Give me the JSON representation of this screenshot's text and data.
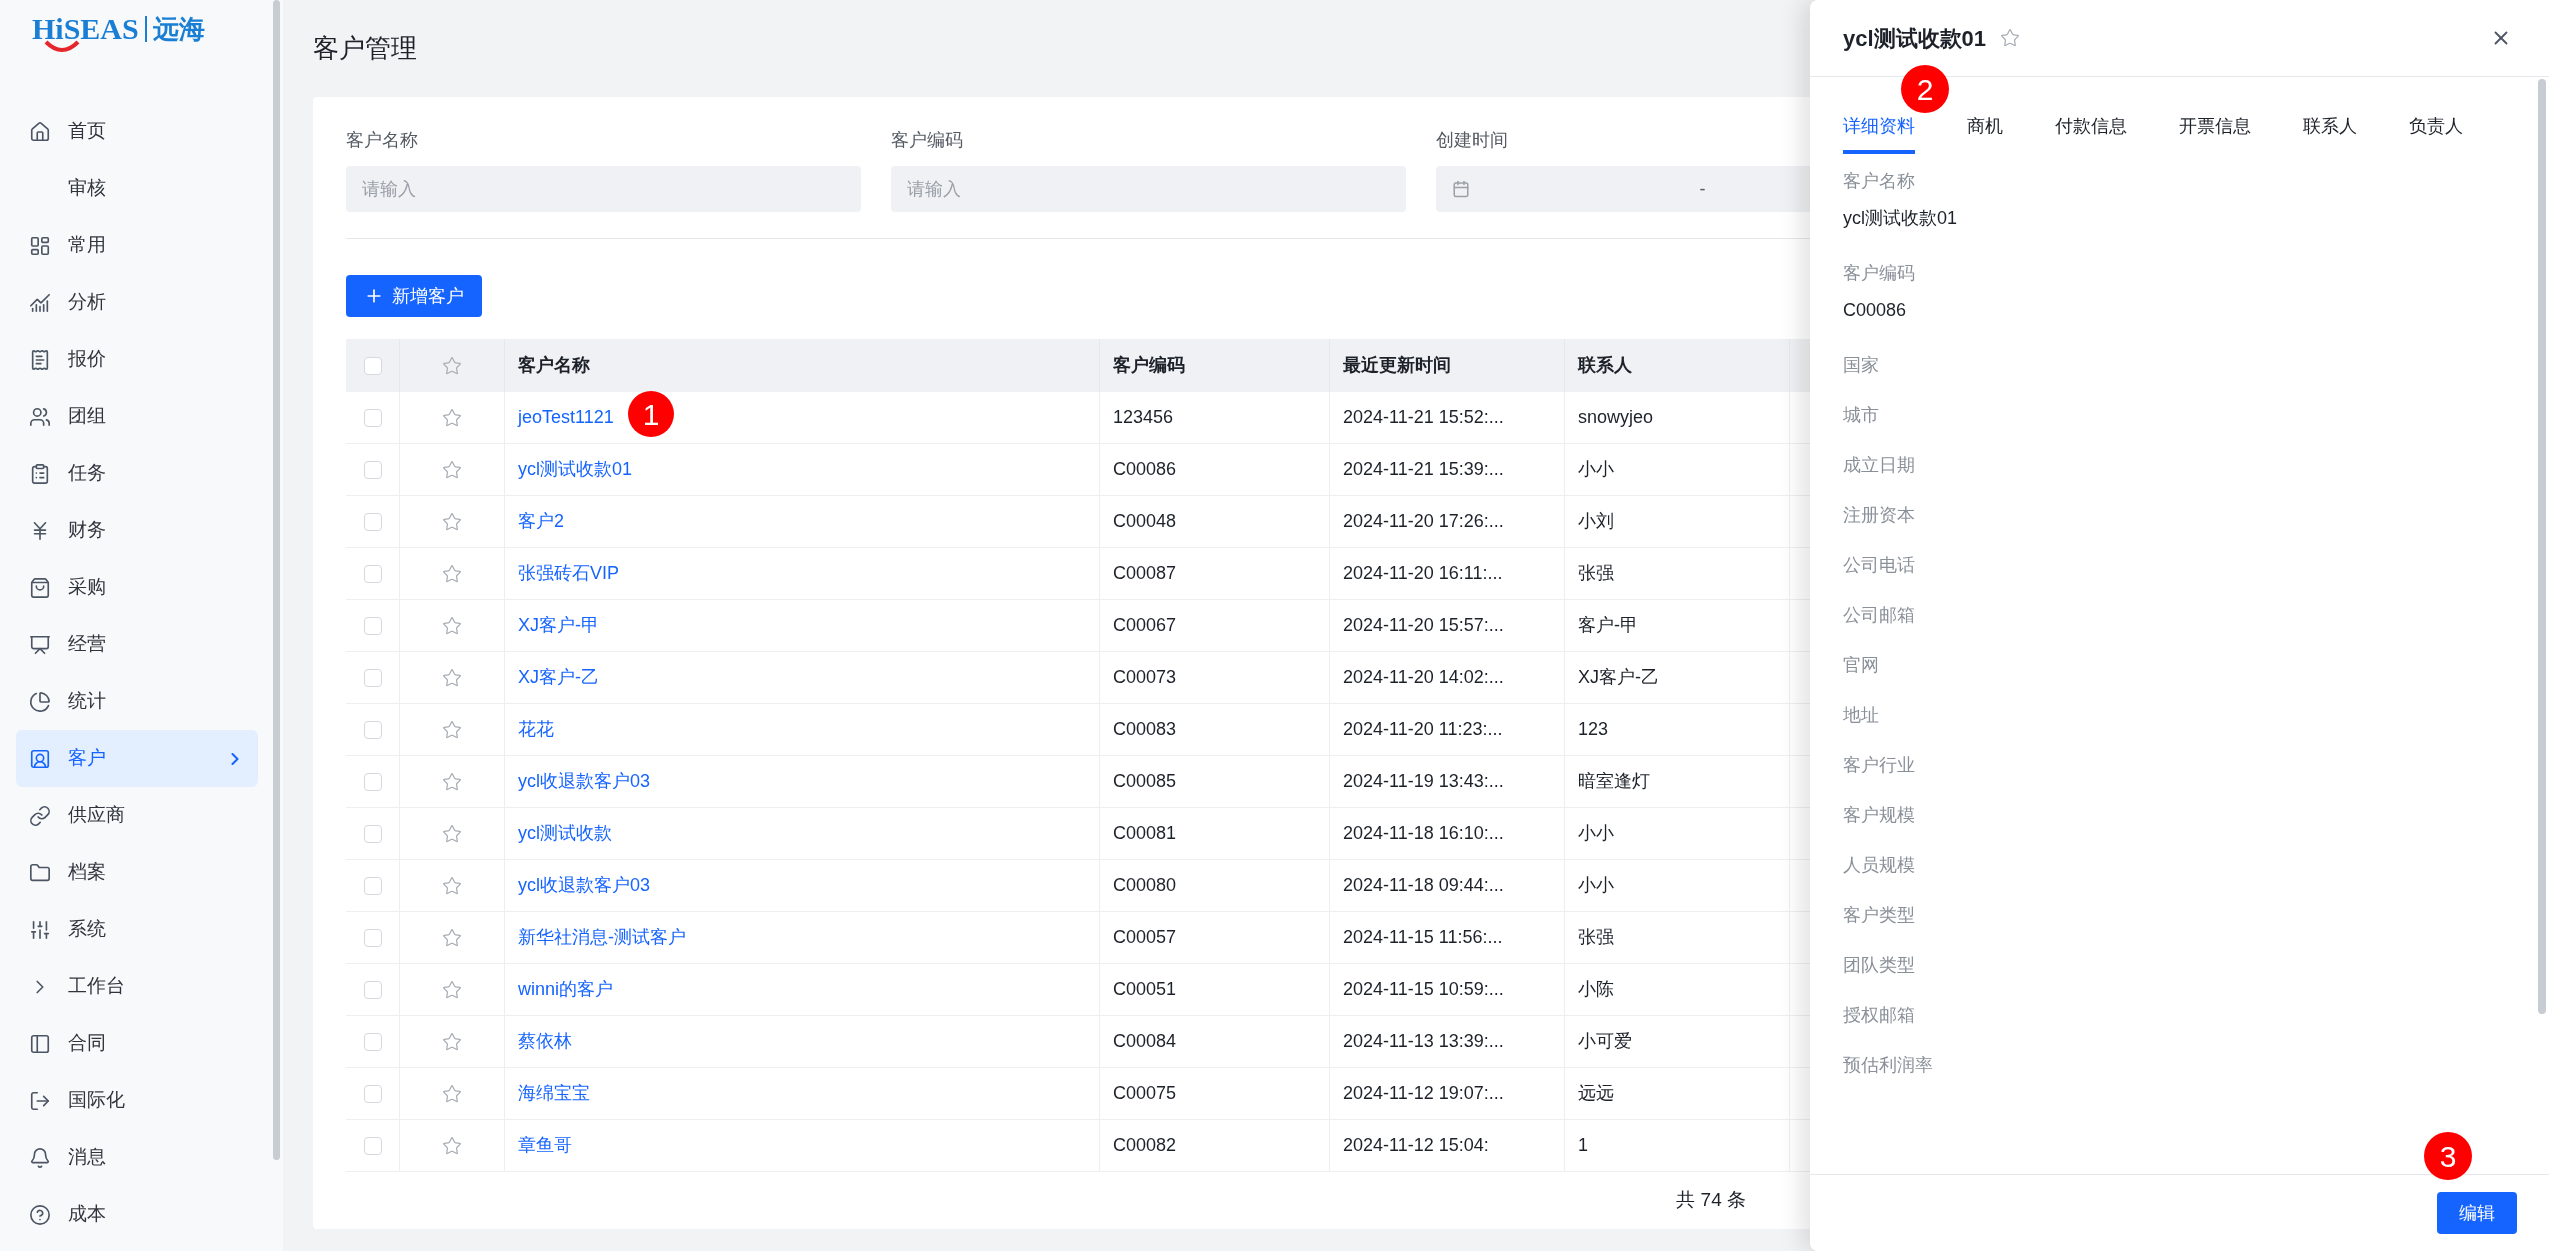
{
  "logo": {
    "brand": "HiSEAS",
    "name": "远海"
  },
  "sidebar": {
    "items": [
      {
        "label": "首页",
        "selected": false
      },
      {
        "label": "审核",
        "selected": false
      },
      {
        "label": "常用",
        "selected": false
      },
      {
        "label": "分析",
        "selected": false
      },
      {
        "label": "报价",
        "selected": false
      },
      {
        "label": "团组",
        "selected": false
      },
      {
        "label": "任务",
        "selected": false
      },
      {
        "label": "财务",
        "selected": false
      },
      {
        "label": "采购",
        "selected": false
      },
      {
        "label": "经营",
        "selected": false
      },
      {
        "label": "统计",
        "selected": false
      },
      {
        "label": "客户",
        "selected": true
      },
      {
        "label": "供应商",
        "selected": false
      },
      {
        "label": "档案",
        "selected": false
      },
      {
        "label": "系统",
        "selected": false
      },
      {
        "label": "工作台",
        "selected": false
      },
      {
        "label": "合同",
        "selected": false
      },
      {
        "label": "国际化",
        "selected": false
      },
      {
        "label": "消息",
        "selected": false
      },
      {
        "label": "成本",
        "selected": false
      }
    ]
  },
  "page_title": "客户管理",
  "filters": [
    {
      "kind": "text",
      "label": "客户名称",
      "placeholder": "请输入"
    },
    {
      "kind": "text",
      "label": "客户编码",
      "placeholder": "请输入"
    },
    {
      "kind": "date_range",
      "label": "创建时间",
      "separator": "-"
    }
  ],
  "add_button": {
    "label": "新增客户"
  },
  "table": {
    "select_all_checked": false,
    "columns": [
      "客户名称",
      "客户编码",
      "最近更新时间",
      "联系人"
    ],
    "rows": [
      {
        "checked": false,
        "starred": false,
        "cells": [
          "jeoTest1121",
          "123456",
          "2024-11-21 15:52:...",
          "snowyjeo"
        ]
      },
      {
        "checked": false,
        "starred": false,
        "cells": [
          "ycl测试收款01",
          "C00086",
          "2024-11-21 15:39:...",
          "小小"
        ]
      },
      {
        "checked": false,
        "starred": false,
        "cells": [
          "客户2",
          "C00048",
          "2024-11-20 17:26:...",
          "小刘"
        ]
      },
      {
        "checked": false,
        "starred": false,
        "cells": [
          "张强砖石VIP",
          "C00087",
          "2024-11-20 16:11:...",
          "张强"
        ]
      },
      {
        "checked": false,
        "starred": false,
        "cells": [
          "XJ客户-甲",
          "C00067",
          "2024-11-20 15:57:...",
          "客户-甲"
        ]
      },
      {
        "checked": false,
        "starred": false,
        "cells": [
          "XJ客户-乙",
          "C00073",
          "2024-11-20 14:02:...",
          "XJ客户-乙"
        ]
      },
      {
        "checked": false,
        "starred": false,
        "cells": [
          "花花",
          "C00083",
          "2024-11-20 11:23:...",
          "123"
        ]
      },
      {
        "checked": false,
        "starred": false,
        "cells": [
          "ycl收退款客户03",
          "C00085",
          "2024-11-19 13:43:...",
          "暗室逢灯"
        ]
      },
      {
        "checked": false,
        "starred": false,
        "cells": [
          "ycl测试收款",
          "C00081",
          "2024-11-18 16:10:...",
          "小小"
        ]
      },
      {
        "checked": false,
        "starred": false,
        "cells": [
          "ycl收退款客户03",
          "C00080",
          "2024-11-18 09:44:...",
          "小小"
        ]
      },
      {
        "checked": false,
        "starred": false,
        "cells": [
          "新华社消息-测试客户",
          "C00057",
          "2024-11-15 11:56:...",
          "张强"
        ]
      },
      {
        "checked": false,
        "starred": false,
        "cells": [
          "winni的客户",
          "C00051",
          "2024-11-15 10:59:...",
          "小陈"
        ]
      },
      {
        "checked": false,
        "starred": false,
        "cells": [
          "蔡依林",
          "C00084",
          "2024-11-13 13:39:...",
          "小可爱"
        ]
      },
      {
        "checked": false,
        "starred": false,
        "cells": [
          "海绵宝宝",
          "C00075",
          "2024-11-12 19:07:...",
          "远远"
        ]
      },
      {
        "checked": false,
        "starred": false,
        "cells": [
          "章鱼哥",
          "C00082",
          "2024-11-12 15:04:",
          "1"
        ]
      }
    ]
  },
  "total": "共 74 条",
  "drawer": {
    "title": "ycl测试收款01",
    "starred": false,
    "tabs": [
      {
        "label": "详细资料",
        "selected": true
      },
      {
        "label": "商机",
        "selected": false
      },
      {
        "label": "付款信息",
        "selected": false
      },
      {
        "label": "开票信息",
        "selected": false
      },
      {
        "label": "联系人",
        "selected": false
      },
      {
        "label": "负责人",
        "selected": false
      }
    ],
    "fields": [
      {
        "label": "客户名称",
        "value": "ycl测试收款01"
      },
      {
        "label": "客户编码",
        "value": "C00086"
      },
      {
        "label": "国家"
      },
      {
        "label": "城市"
      },
      {
        "label": "成立日期"
      },
      {
        "label": "注册资本"
      },
      {
        "label": "公司电话"
      },
      {
        "label": "公司邮箱"
      },
      {
        "label": "官网"
      },
      {
        "label": "地址"
      },
      {
        "label": "客户行业"
      },
      {
        "label": "客户规模"
      },
      {
        "label": "人员规模"
      },
      {
        "label": "客户类型"
      },
      {
        "label": "团队类型"
      },
      {
        "label": "授权邮箱"
      },
      {
        "label": "预估利润率"
      }
    ],
    "edit_button": "编辑"
  },
  "markers": [
    "1",
    "2",
    "3"
  ]
}
